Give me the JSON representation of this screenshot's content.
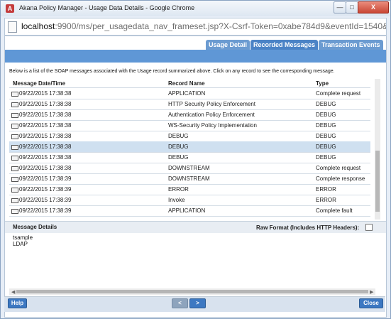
{
  "window": {
    "title": "Akana Policy Manager - Usage Data Details - Google Chrome",
    "min_label": "—",
    "max_label": "□",
    "close_label": "X",
    "icon_letter": "A"
  },
  "address": {
    "host": "localhost",
    "rest": ":9900/ms/per_usagedata_nav_frameset.jsp?X-Csrf-Token=0xabe784d9&eventId=1540&s"
  },
  "tabs": [
    "Usage Detail",
    "Recorded Messages",
    "Transaction Events"
  ],
  "intro_text": "Below is a list of the SOAP messages associated with the Usage record summarized above. Click on any record to see the corresponding message.",
  "table": {
    "headers": [
      "Message Date/Time",
      "Record Name",
      "Type"
    ],
    "rows": [
      [
        "09/22/2015 17:38:38",
        "APPLICATION",
        "Complete request"
      ],
      [
        "09/22/2015 17:38:38",
        "HTTP Security Policy Enforcement",
        "DEBUG"
      ],
      [
        "09/22/2015 17:38:38",
        "Authentication Policy Enforcement",
        "DEBUG"
      ],
      [
        "09/22/2015 17:38:38",
        "WS-Security Policy Implementation",
        "DEBUG"
      ],
      [
        "09/22/2015 17:38:38",
        "DEBUG",
        "DEBUG"
      ],
      [
        "09/22/2015 17:38:38",
        "DEBUG",
        "DEBUG"
      ],
      [
        "09/22/2015 17:38:38",
        "DEBUG",
        "DEBUG"
      ],
      [
        "09/22/2015 17:38:38",
        "DOWNSTREAM",
        "Complete request"
      ],
      [
        "09/22/2015 17:38:39",
        "DOWNSTREAM",
        "Complete response"
      ],
      [
        "09/22/2015 17:38:39",
        "ERROR",
        "ERROR"
      ],
      [
        "09/22/2015 17:38:39",
        "Invoke",
        "ERROR"
      ],
      [
        "09/22/2015 17:38:39",
        "APPLICATION",
        "Complete fault"
      ]
    ]
  },
  "details": {
    "title": "Message Details",
    "raw_format_label": "Raw Format (Includes HTTP Headers):",
    "lines": [
      "tsample",
      "LDAP"
    ]
  },
  "scroll": {
    "left_label": "◀",
    "right_label": "▶"
  },
  "buttons": {
    "help": "Help",
    "prev": "<",
    "next": ">",
    "close": "Close"
  }
}
